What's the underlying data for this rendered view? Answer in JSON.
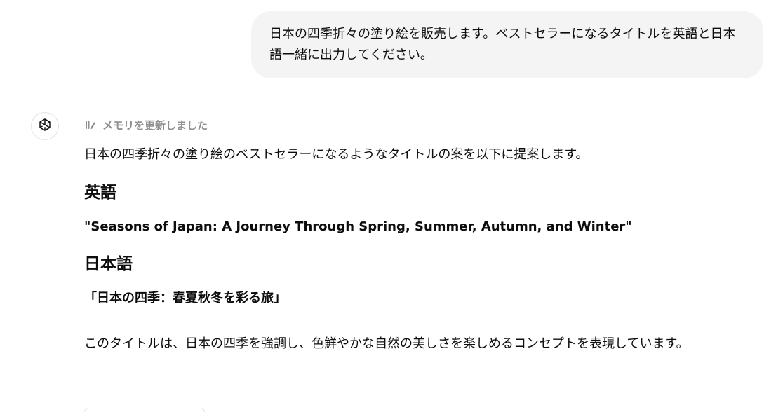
{
  "user_message": {
    "text": "日本の四季折々の塗り絵を販売します。ベストセラーになるタイトルを英語と日本語一緒に出力してください。"
  },
  "assistant": {
    "avatar_icon": "openai-logo-icon",
    "memory_icon": "memory-pencil-icon",
    "memory_status": "メモリを更新しました",
    "intro": "日本の四季折々の塗り絵のベストセラーになるようなタイトルの案を以下に提案します。",
    "english_heading": "英語",
    "english_title": "\"Seasons of Japan: A Journey Through Spring, Summer, Autumn, and Winter\"",
    "japanese_heading": "日本語",
    "japanese_title": "「日本の四季：春夏秋冬を彩る旅」",
    "summary": "このタイトルは、日本の四季を強調し、色鮮やかな自然の美しさを楽しめるコンセプトを表現しています。"
  },
  "colors": {
    "bubble_bg": "#f4f4f4",
    "muted_text": "#8f8f8f",
    "text": "#0d0d0d"
  }
}
